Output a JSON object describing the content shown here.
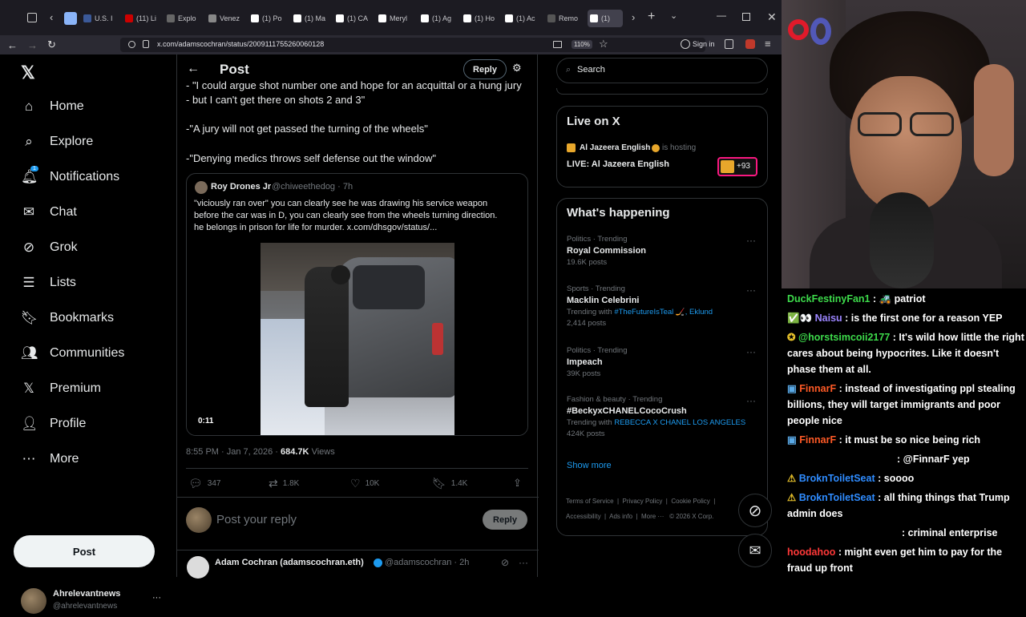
{
  "browser": {
    "tabs": [
      {
        "label": "U.S. I",
        "color": "#3b5998"
      },
      {
        "label": "(11) Li",
        "color": "#cc0000"
      },
      {
        "label": "Explo",
        "color": "#666"
      },
      {
        "label": "Venez",
        "color": "#888"
      },
      {
        "label": "(1) Po",
        "color": "#fff"
      },
      {
        "label": "(1) Ma",
        "color": "#fff"
      },
      {
        "label": "(1) CA",
        "color": "#fff"
      },
      {
        "label": "Meryl",
        "color": "#fff"
      },
      {
        "label": "(1) Ag",
        "color": "#fff"
      },
      {
        "label": "(1) Ho",
        "color": "#fff"
      },
      {
        "label": "(1) Ac",
        "color": "#fff"
      },
      {
        "label": "Remo",
        "color": "#555"
      },
      {
        "label": "(1)",
        "color": "#fff"
      }
    ],
    "url": "x.com/adamscochran/status/2009111755260060128",
    "zoom": "110%",
    "signin": "Sign in"
  },
  "sidebar": {
    "items": [
      {
        "label": "Home",
        "icon": "home-icon"
      },
      {
        "label": "Explore",
        "icon": "search-icon"
      },
      {
        "label": "Notifications",
        "icon": "bell-icon",
        "badge": "1"
      },
      {
        "label": "Chat",
        "icon": "mail-icon"
      },
      {
        "label": "Grok",
        "icon": "grok-icon"
      },
      {
        "label": "Lists",
        "icon": "list-icon"
      },
      {
        "label": "Bookmarks",
        "icon": "bookmark-icon"
      },
      {
        "label": "Communities",
        "icon": "communities-icon"
      },
      {
        "label": "Premium",
        "icon": "x-icon"
      },
      {
        "label": "Profile",
        "icon": "person-icon"
      },
      {
        "label": "More",
        "icon": "more-circle-icon"
      }
    ],
    "post_button": "Post",
    "account": {
      "name": "Ahrelevantnews",
      "handle": "@ahrelevantnews"
    }
  },
  "main": {
    "title": "Post",
    "reply_button": "Reply",
    "lines": [
      "- \"I could argue shot number one and hope for an acquittal or a hung jury",
      "- but I can't get there on shots 2 and 3\"",
      "-\"A jury will not get passed the turning of the wheels\"",
      "-\"Denying medics throws self defense out the window\""
    ],
    "quote": {
      "name": "Roy Drones Jr",
      "handle": "@chiweethedog · 7h",
      "text1": "\"viciously ran over\" you can clearly see he was drawing his service weapon",
      "text2": "before the car was in D, you can clearly see from the wheels turning direction.",
      "text3": "he belongs in prison for life for murder.",
      "link": "x.com/dhsgov/status/...",
      "duration": "0:11"
    },
    "timestamp": "8:55 PM · Jan 7, 2026 ·",
    "views_count": "684.7K",
    "views_label": "Views",
    "stats": {
      "replies": "347",
      "reposts": "1.8K",
      "likes": "10K",
      "bookmarks": "1.4K"
    },
    "reply_placeholder": "Post your reply",
    "reply_submit": "Reply",
    "next_post": {
      "name": "Adam Cochran (adamscochran.eth)",
      "handle": "@adamscochran · 2h"
    }
  },
  "right": {
    "search_placeholder": "Search",
    "live": {
      "heading": "Live on X",
      "host": "Al Jazeera English",
      "hosting": "is hosting",
      "title": "LIVE: Al Jazeera English",
      "count": "+93"
    },
    "happening": {
      "heading": "What's happening",
      "trends": [
        {
          "meta": "Politics · Trending",
          "name": "Royal Commission",
          "sub": "",
          "posts": "19.6K posts"
        },
        {
          "meta": "Sports · Trending",
          "name": "Macklin Celebrini",
          "sub": "Trending with #TheFutureIsTeal 🏒, Eklund",
          "posts": "2,414 posts"
        },
        {
          "meta": "Politics · Trending",
          "name": "Impeach",
          "sub": "",
          "posts": "39K posts"
        },
        {
          "meta": "Fashion & beauty · Trending",
          "name": "#BeckyxCHANELCocoCrush",
          "sub": "Trending with REBECCA X CHANEL LOS ANGELES",
          "posts": "424K posts"
        }
      ],
      "show_more": "Show more"
    },
    "footer": [
      "Terms of Service",
      "Privacy Policy",
      "Cookie Policy",
      "Accessibility",
      "Ads info",
      "More ···",
      "© 2026 X Corp."
    ]
  },
  "chat": {
    "messages": [
      {
        "user": "DuckFestinyFan1",
        "text": ": 🚜 patriot",
        "color": "green"
      },
      {
        "user": "Naisu",
        "text": ": is the first one for a reason YEP",
        "color": "purple"
      },
      {
        "user": "@horstsimcoii2177",
        "text": ": It's wild how little the right cares about being hypocrites. Like it doesn't phase them at all.",
        "color": "green"
      },
      {
        "user": "FinnarF",
        "text": ": instead of investigating ppl stealing billions, they will target immigrants and poor people nice",
        "color": "orange"
      },
      {
        "user": "FinnarF",
        "text": ": it must be so nice being rich",
        "color": "orange"
      },
      {
        "user": "",
        "text": ": @FinnarF yep",
        "color": "blue"
      },
      {
        "user": "BroknToiletSeat",
        "text": ": soooo",
        "color": "blue"
      },
      {
        "user": "BroknToiletSeat",
        "text": ": all thing things that Trump admin does",
        "color": "blue"
      },
      {
        "user": "",
        "text": ": criminal enterprise",
        "color": "blue"
      },
      {
        "user": "hoodahoo",
        "text": ": might even get him to pay for the fraud up front",
        "color": "red"
      }
    ]
  }
}
